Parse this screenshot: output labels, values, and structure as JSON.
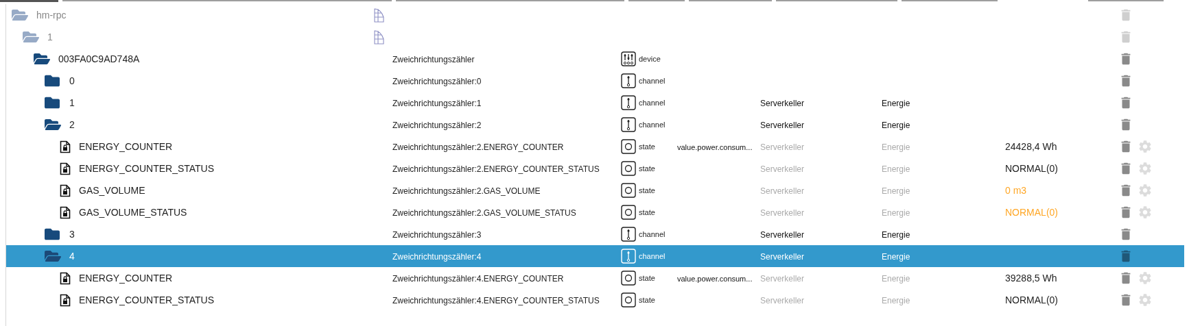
{
  "tree": [
    {
      "kind": "instance",
      "name": "hm-rpc",
      "expanded": true,
      "selected": false,
      "children": [
        {
          "kind": "instance",
          "name": "1",
          "expanded": true,
          "selected": false,
          "children": [
            {
              "kind": "folder",
              "name": "003FA0C9AD748A",
              "expanded": true,
              "selected": false,
              "label": "Zweichrichtungszähler",
              "type": {
                "kind": "device",
                "label": "device"
              },
              "children": [
                {
                  "kind": "folder",
                  "name": "0",
                  "expanded": false,
                  "selected": false,
                  "label": "Zweichrichtungszähler:0",
                  "type": {
                    "kind": "channel",
                    "label": "channel"
                  }
                },
                {
                  "kind": "folder",
                  "name": "1",
                  "expanded": false,
                  "selected": false,
                  "label": "Zweichrichtungszähler:1",
                  "type": {
                    "kind": "channel",
                    "label": "channel"
                  },
                  "room": "Serverkeller",
                  "function": "Energie"
                },
                {
                  "kind": "folder",
                  "name": "2",
                  "expanded": true,
                  "selected": false,
                  "label": "Zweichrichtungszähler:2",
                  "type": {
                    "kind": "channel",
                    "label": "channel"
                  },
                  "room": "Serverkeller",
                  "function": "Energie",
                  "children": [
                    {
                      "kind": "state",
                      "name": "ENERGY_COUNTER",
                      "selected": false,
                      "label": "Zweichrichtungszähler:2.ENERGY_COUNTER",
                      "type": {
                        "kind": "state",
                        "label": "state"
                      },
                      "role": "value.power.consum...",
                      "room": "Serverkeller",
                      "function": "Energie",
                      "value": "24428,4 Wh",
                      "color": "#222222"
                    },
                    {
                      "kind": "state",
                      "name": "ENERGY_COUNTER_STATUS",
                      "selected": false,
                      "label": "Zweichrichtungszähler:2.ENERGY_COUNTER_STATUS",
                      "type": {
                        "kind": "state",
                        "label": "state"
                      },
                      "room": "Serverkeller",
                      "function": "Energie",
                      "value": "NORMAL(0)",
                      "color": "#222222"
                    },
                    {
                      "kind": "state",
                      "name": "GAS_VOLUME",
                      "selected": false,
                      "label": "Zweichrichtungszähler:2.GAS_VOLUME",
                      "type": {
                        "kind": "state",
                        "label": "state"
                      },
                      "room": "Serverkeller",
                      "function": "Energie",
                      "value": "0 m3",
                      "color": "#ffa726"
                    },
                    {
                      "kind": "state",
                      "name": "GAS_VOLUME_STATUS",
                      "selected": false,
                      "label": "Zweichrichtungszähler:2.GAS_VOLUME_STATUS",
                      "type": {
                        "kind": "state",
                        "label": "state"
                      },
                      "room": "Serverkeller",
                      "function": "Energie",
                      "value": "NORMAL(0)",
                      "color": "#ffa726"
                    }
                  ]
                },
                {
                  "kind": "folder",
                  "name": "3",
                  "expanded": false,
                  "selected": false,
                  "label": "Zweichrichtungszähler:3",
                  "type": {
                    "kind": "channel",
                    "label": "channel"
                  },
                  "room": "Serverkeller",
                  "function": "Energie"
                },
                {
                  "kind": "folder",
                  "name": "4",
                  "expanded": true,
                  "selected": true,
                  "label": "Zweichrichtungszähler:4",
                  "type": {
                    "kind": "channel",
                    "label": "channel"
                  },
                  "room": "Serverkeller",
                  "function": "Energie",
                  "children": [
                    {
                      "kind": "state",
                      "name": "ENERGY_COUNTER",
                      "selected": false,
                      "label": "Zweichrichtungszähler:4.ENERGY_COUNTER",
                      "type": {
                        "kind": "state",
                        "label": "state"
                      },
                      "role": "value.power.consum...",
                      "room": "Serverkeller",
                      "function": "Energie",
                      "value": "39288,5 Wh",
                      "color": "#222222"
                    },
                    {
                      "kind": "state",
                      "name": "ENERGY_COUNTER_STATUS",
                      "selected": false,
                      "label": "Zweichrichtungszähler:4.ENERGY_COUNTER_STATUS",
                      "type": {
                        "kind": "state",
                        "label": "state"
                      },
                      "room": "Serverkeller",
                      "function": "Energie",
                      "value": "NORMAL(0)",
                      "color": "#222222"
                    }
                  ]
                }
              ]
            }
          ]
        }
      ]
    }
  ]
}
